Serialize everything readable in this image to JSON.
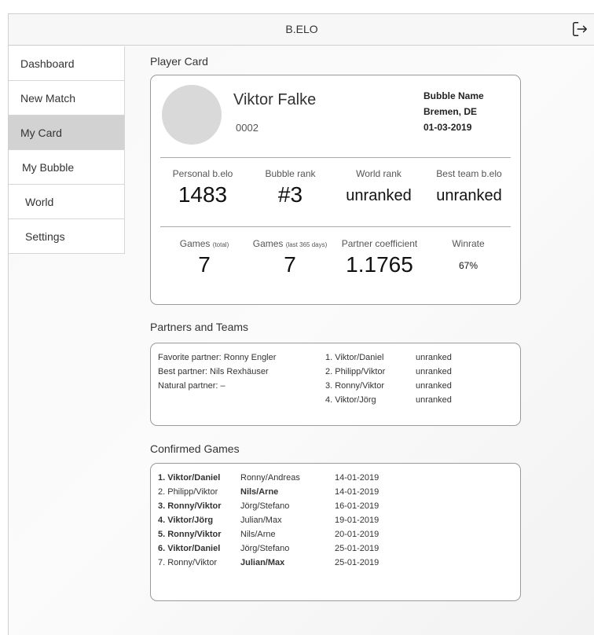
{
  "app": {
    "title": "B.ELO"
  },
  "sidebar": {
    "items": [
      {
        "label": "Dashboard"
      },
      {
        "label": "New Match"
      },
      {
        "label": "My Card",
        "active": true
      },
      {
        "label": "My Bubble"
      },
      {
        "label": "World"
      },
      {
        "label": "Settings"
      }
    ]
  },
  "player_card": {
    "section_title": "Player Card",
    "name": "Viktor Falke",
    "id": "0002",
    "bubble_name": "Bubble Name",
    "location": "Bremen, DE",
    "date": "01-03-2019",
    "stats_row1": [
      {
        "label": "Personal b.elo",
        "value": "1483"
      },
      {
        "label": "Bubble rank",
        "value": "#3"
      },
      {
        "label": "World rank",
        "value": "unranked"
      },
      {
        "label": "Best team b.elo",
        "value": "unranked"
      }
    ],
    "stats_row2": [
      {
        "label": "Games",
        "label_small": "(total)",
        "value": "7"
      },
      {
        "label": "Games",
        "label_small": "(last 365 days)",
        "value": "7"
      },
      {
        "label": "Partner coefficient",
        "value": "1.1765"
      },
      {
        "label": "Winrate",
        "value": "67%"
      }
    ]
  },
  "partners": {
    "section_title": "Partners and Teams",
    "favorite": "Favorite partner: Ronny Engler",
    "best": "Best partner: Nils Rexhäuser",
    "natural": "Natural partner:  –",
    "teams": [
      {
        "name": "1. Viktor/Daniel",
        "rank": "unranked"
      },
      {
        "name": "2. Philipp/Viktor",
        "rank": "unranked"
      },
      {
        "name": "3. Ronny/Viktor",
        "rank": "unranked"
      },
      {
        "name": "4. Viktor/Jörg",
        "rank": "unranked"
      }
    ]
  },
  "games": {
    "section_title": "Confirmed Games",
    "rows": [
      {
        "team": "1. Viktor/Daniel",
        "team_bold": true,
        "opponent": "Ronny/Andreas",
        "opponent_bold": false,
        "date": "14-01-2019"
      },
      {
        "team": "2. Philipp/Viktor",
        "team_bold": false,
        "opponent": "Nils/Arne",
        "opponent_bold": true,
        "date": "14-01-2019"
      },
      {
        "team": "3. Ronny/Viktor",
        "team_bold": true,
        "opponent": "Jörg/Stefano",
        "opponent_bold": false,
        "date": "16-01-2019"
      },
      {
        "team": "4. Viktor/Jörg",
        "team_bold": true,
        "opponent": "Julian/Max",
        "opponent_bold": false,
        "date": "19-01-2019"
      },
      {
        "team": "5. Ronny/Viktor",
        "team_bold": true,
        "opponent": "Nils/Arne",
        "opponent_bold": false,
        "date": "20-01-2019"
      },
      {
        "team": "6. Viktor/Daniel",
        "team_bold": true,
        "opponent": "Jörg/Stefano",
        "opponent_bold": false,
        "date": "25-01-2019"
      },
      {
        "team": "7. Ronny/Viktor",
        "team_bold": false,
        "opponent": "Julian/Max",
        "opponent_bold": true,
        "date": "25-01-2019"
      }
    ]
  }
}
